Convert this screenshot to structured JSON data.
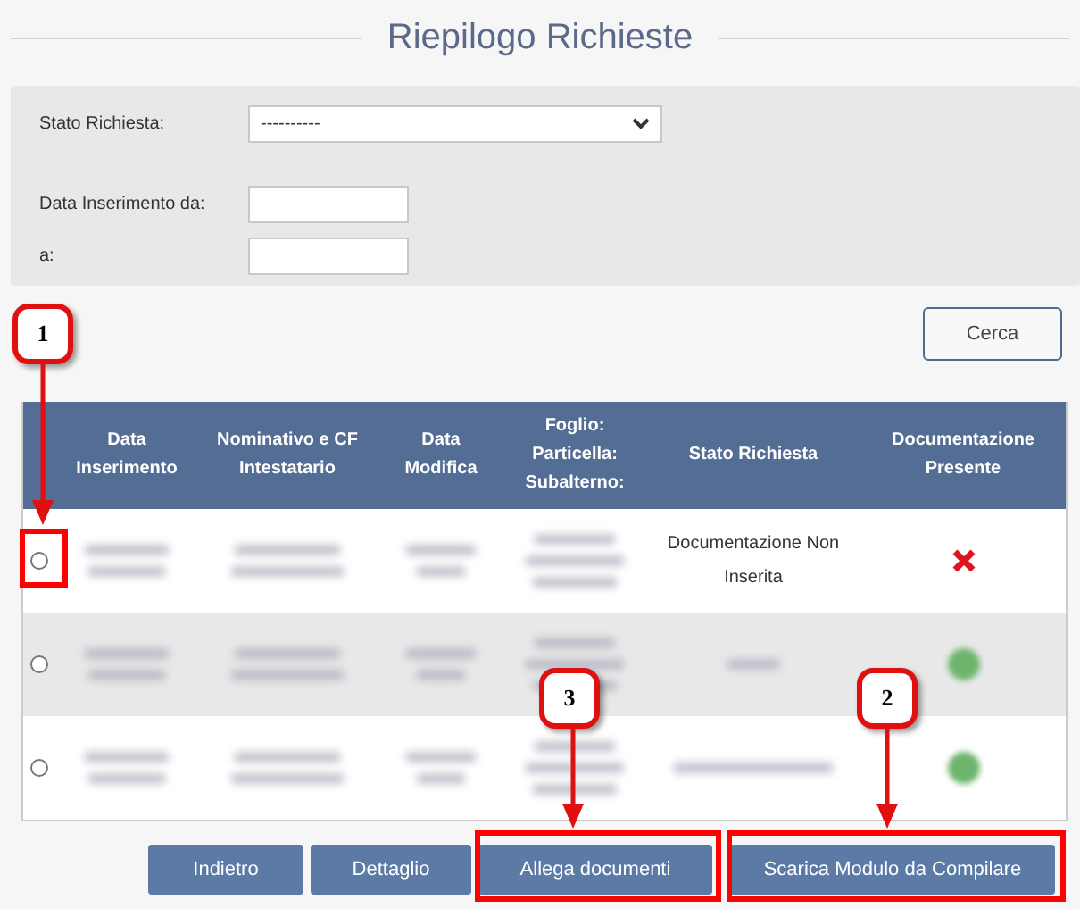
{
  "title": "Riepilogo Richieste",
  "filters": {
    "status_label": "Stato Richiesta:",
    "status_value": "----------",
    "date_from_label": "Data Inserimento da:",
    "date_to_label": "a:"
  },
  "search_button": "Cerca",
  "table": {
    "columns": [
      "Data Inserimento",
      "Nominativo e CF Intestatario",
      "Data Modifica",
      "Foglio: Particella: Subalterno:",
      "Stato Richiesta",
      "Documentazione Presente"
    ],
    "rows": [
      {
        "selected": false,
        "status": "Documentazione Non Inserita",
        "documents_present": false
      },
      {
        "selected": false,
        "documents_present": true
      },
      {
        "selected": false,
        "documents_present": true
      }
    ]
  },
  "buttons": [
    "Indietro",
    "Dettaglio",
    "Allega documenti",
    "Scarica Modulo da Compilare"
  ],
  "callouts": [
    {
      "number": "1"
    },
    {
      "number": "2"
    },
    {
      "number": "3"
    }
  ]
}
